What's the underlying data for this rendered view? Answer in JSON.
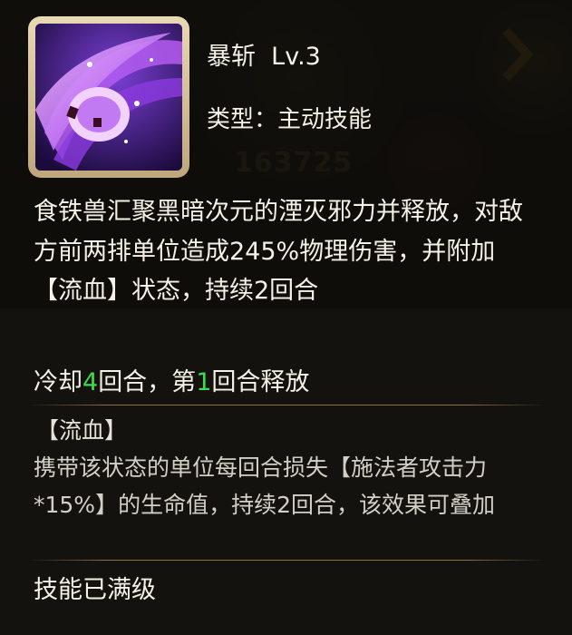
{
  "skill": {
    "name": "暴斩  Lv.3",
    "type_label": "类型：主动技能",
    "icon": "purple-slash-icon"
  },
  "description": "食铁兽汇聚黑暗次元的湮灭邪力并释放，对敌方前两排单位造成245%物理伤害，并附加【流血】状态，持续2回合",
  "cooldown": {
    "part1": "冷却",
    "turns": "4",
    "part2": "回合，第",
    "release_turn": "1",
    "part3": "回合释放"
  },
  "status_effect": {
    "title": "【流血】",
    "description": "携带该状态的单位每回合损失【施法者攻击力*15%】的生命值，持续2回合，该效果可叠加"
  },
  "max_level_text": "技能已满级",
  "background": {
    "score": "163725"
  },
  "colors": {
    "highlight": "#3ddc4c",
    "text": "#f6f1e7",
    "frame": "#d8c69e"
  }
}
